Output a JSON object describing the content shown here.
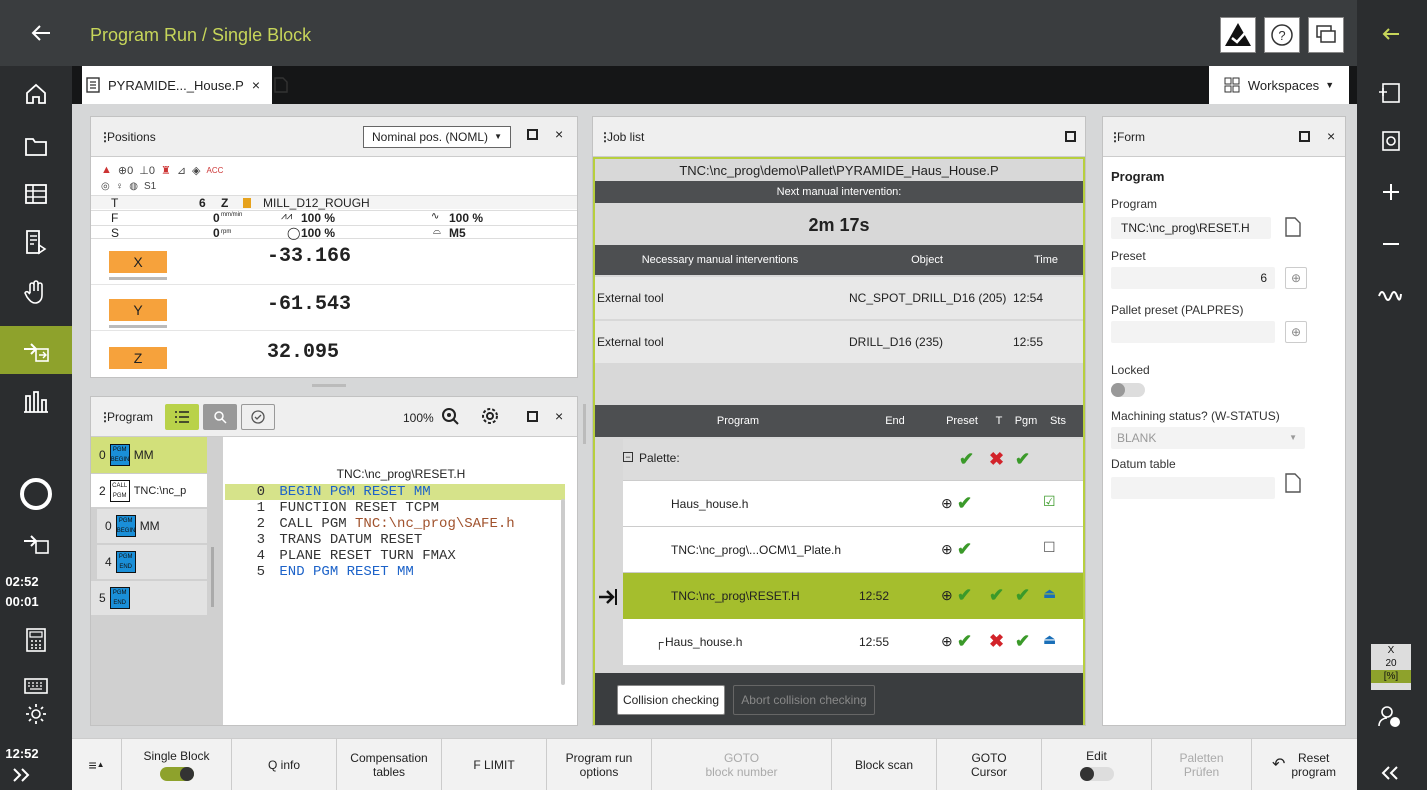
{
  "topbar": {
    "title": "Program Run / Single Block"
  },
  "tabbar": {
    "tab_label": "PYRAMIDE..._House.P",
    "workspaces_label": "Workspaces"
  },
  "clock": {
    "elapsed1": "02:52",
    "elapsed2": "00:01",
    "time": "12:52"
  },
  "positions": {
    "title": "Positions",
    "mode_select": "Nominal pos. (NOML)",
    "status_row1": [
      "⊕0",
      "⊥0"
    ],
    "status_s1": "S1",
    "tool_T": "T",
    "tool_num": "6",
    "tool_axis": "Z",
    "tool_name": "MILL_D12_ROUGH",
    "F_label": "F",
    "F_val": "0",
    "F_unit": "mm/min",
    "F_ovr": "100 %",
    "F_ovr2": "100 %",
    "S_label": "S",
    "S_val": "0",
    "S_unit": "rpm",
    "S_ovr": "100 %",
    "S_m": "M5",
    "axes": [
      {
        "name": "X",
        "value": "-33.166"
      },
      {
        "name": "Y",
        "value": "-61.543"
      },
      {
        "name": "Z",
        "value": "32.095"
      }
    ]
  },
  "program": {
    "title": "Program",
    "zoom": "100%",
    "tree": [
      {
        "num": "0",
        "tag": "PGM BEGIN",
        "label": "MM"
      },
      {
        "num": "2",
        "tag": "CALL PGM",
        "label": "TNC:\\nc_p"
      },
      {
        "num": "0",
        "tag": "PGM BEGIN",
        "label": "MM"
      },
      {
        "num": "4",
        "tag": "PGM END",
        "label": ""
      },
      {
        "num": "5",
        "tag": "PGM END",
        "label": ""
      }
    ],
    "file": "TNC:\\nc_prog\\RESET.H",
    "lines": [
      {
        "n": "0",
        "text": "BEGIN PGM RESET MM"
      },
      {
        "n": "1",
        "text": "FUNCTION RESET TCPM"
      },
      {
        "n": "2",
        "text": "CALL PGM ",
        "text2": "TNC:\\nc_prog\\SAFE.h"
      },
      {
        "n": "3",
        "text": "TRANS DATUM RESET"
      },
      {
        "n": "4",
        "text": "PLANE RESET TURN FMAX"
      },
      {
        "n": "5",
        "text": "END PGM RESET MM"
      }
    ]
  },
  "joblist": {
    "title": "Job list",
    "path": "TNC:\\nc_prog\\demo\\Pallet\\PYRAMIDE_Haus_House.P",
    "next_label": "Next manual intervention:",
    "next_time": "2m 17s",
    "int_headers": [
      "Necessary manual interventions",
      "Object",
      "Time"
    ],
    "interventions": [
      {
        "type": "External tool",
        "object": "NC_SPOT_DRILL_D16 (205)",
        "time": "12:54"
      },
      {
        "type": "External tool",
        "object": "DRILL_D16 (235)",
        "time": "12:55"
      }
    ],
    "prog_headers": [
      "Program",
      "End",
      "Preset",
      "T",
      "Pgm",
      "Sts"
    ],
    "rows": [
      {
        "program": "Palette:",
        "end": ""
      },
      {
        "program": "Haus_house.h",
        "end": ""
      },
      {
        "program": "TNC:\\nc_prog\\...OCM\\1_Plate.h",
        "end": ""
      },
      {
        "program": "TNC:\\nc_prog\\RESET.H",
        "end": "12:52"
      },
      {
        "program": "Haus_house.h",
        "end": "12:55"
      }
    ],
    "btn_collision": "Collision checking",
    "btn_abort": "Abort collision checking"
  },
  "form": {
    "title": "Form",
    "section": "Program",
    "program_label": "Program",
    "program_value": "TNC:\\nc_prog\\RESET.H",
    "preset_label": "Preset",
    "preset_value": "6",
    "pallet_preset_label": "Pallet preset (PALPRES)",
    "locked_label": "Locked",
    "machining_label": "Machining status? (W-STATUS)",
    "machining_value": "BLANK",
    "datum_label": "Datum table"
  },
  "rightbar": {
    "x_label": "X",
    "x_value": "20",
    "x_unit": "[%]"
  },
  "bottombar": {
    "single_block": "Single Block",
    "q_info": "Q info",
    "comp1": "Compensation",
    "comp2": "tables",
    "f_limit": "F LIMIT",
    "pro1": "Program run",
    "pro2": "options",
    "goto1": "GOTO",
    "goto2": "block number",
    "block_scan": "Block scan",
    "gc1": "GOTO",
    "gc2": "Cursor",
    "edit": "Edit",
    "pal1": "Paletten",
    "pal2": "Prüfen",
    "reset1": "Reset",
    "reset2": "program"
  },
  "colors": {
    "accent": "#8ea22c",
    "axis": "#f6a23c",
    "title": "#c7d65a"
  }
}
